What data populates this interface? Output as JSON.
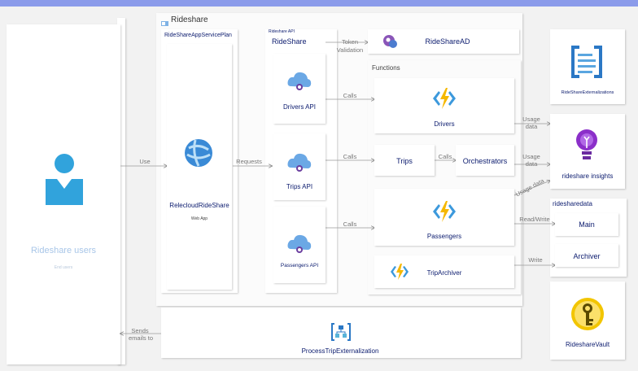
{
  "group_title": "Rideshare",
  "plan": {
    "title": "RideShareAppServicePlan",
    "app_name": "RelecloudRideShare",
    "app_type": "Web App"
  },
  "users": {
    "name": "Rideshare users",
    "subtitle": "End users"
  },
  "api": {
    "small_title": "Rideshare API",
    "title": "RideShare",
    "items": [
      "Drivers API",
      "Trips API",
      "Passengers API"
    ]
  },
  "ad": {
    "name": "RideShareAD"
  },
  "functions": {
    "title": "Functions",
    "drivers": "Drivers",
    "trips": "Trips",
    "orchestrators": "Orchestrators",
    "passengers": "Passengers",
    "triparchiver": "TripArchiver"
  },
  "right": {
    "externalizations": "RideShareExternalizations",
    "insights": "rideshare insights",
    "data_title": "ridesharedata",
    "main": "Main",
    "archiver": "Archiver",
    "vault": "RideshareVault"
  },
  "process": {
    "name": "ProcessTripExternalization"
  },
  "edges": {
    "use": "Use",
    "requests": "Requests",
    "token_1": "Token",
    "token_2": "Validation",
    "calls": "Calls",
    "usage_1": "Usage",
    "usage_2": "data",
    "usage_diag": "Usage data",
    "read_write": "Read/Write",
    "write": "Write",
    "sends_1": "Sends",
    "sends_2": "emails to"
  }
}
